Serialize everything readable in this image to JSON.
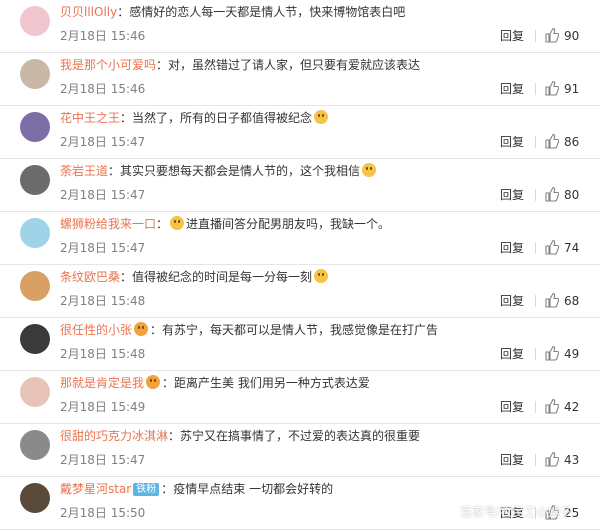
{
  "comments": [
    {
      "user": "贝贝lllOlly",
      "text": "：感情好的恋人每一天都是情人节，快来博物馆表白吧",
      "time": "2月18日 15:46",
      "reply": "回复",
      "likes": "90",
      "avatar_color": "#f2c6cf",
      "emoji": null,
      "badge": null,
      "prefix_emoji": false
    },
    {
      "user": "我是那个小可爱吗",
      "text": "：对，虽然错过了请人家，但只要有爱就应该表达",
      "time": "2月18日 15:46",
      "reply": "回复",
      "likes": "91",
      "avatar_color": "#c9b8a6",
      "emoji": null,
      "badge": null,
      "prefix_emoji": false
    },
    {
      "user": "花中王之王",
      "text": "：当然了，所有的日子都值得被纪念",
      "time": "2月18日 15:47",
      "reply": "回复",
      "likes": "86",
      "avatar_color": "#7d6ea8",
      "emoji": "smile",
      "badge": null,
      "prefix_emoji": false
    },
    {
      "user": "荼岩王道",
      "text": "：其实只要想每天都会是情人节的，这个我相信",
      "time": "2月18日 15:47",
      "reply": "回复",
      "likes": "80",
      "avatar_color": "#6b6b6b",
      "emoji": "grin",
      "badge": null,
      "prefix_emoji": false
    },
    {
      "user": "螺狮粉给我来一口",
      "text": "进直播间答分配男朋友吗，我缺一个。",
      "time": "2月18日 15:47",
      "reply": "回复",
      "likes": "74",
      "avatar_color": "#9fd3e8",
      "emoji": null,
      "badge": null,
      "prefix_emoji": true,
      "name_suffix": "："
    },
    {
      "user": "条纹欧巴桑",
      "text": "：值得被纪念的时间是每一分每一刻",
      "time": "2月18日 15:48",
      "reply": "回复",
      "likes": "68",
      "avatar_color": "#d9a066",
      "emoji": "wow",
      "badge": null,
      "prefix_emoji": false
    },
    {
      "user": "很任性的小张",
      "text": "：有苏宁，每天都可以是情人节，我感觉像是在打广告",
      "time": "2月18日 15:48",
      "reply": "回复",
      "likes": "49",
      "avatar_color": "#3a3a3a",
      "emoji": null,
      "badge": null,
      "prefix_emoji": false,
      "name_emoji": true
    },
    {
      "user": "那就是肯定是我",
      "text": "：距离产生美  我们用另一种方式表达爱",
      "time": "2月18日 15:49",
      "reply": "回复",
      "likes": "42",
      "avatar_color": "#e8c4b8",
      "emoji": null,
      "badge": null,
      "prefix_emoji": false,
      "name_emoji": true
    },
    {
      "user": "很甜的巧克力冰淇淋",
      "text": "：苏宁又在搞事情了，不过爱的表达真的很重要",
      "time": "2月18日 15:47",
      "reply": "回复",
      "likes": "43",
      "avatar_color": "#8a8a8a",
      "emoji": null,
      "badge": null,
      "prefix_emoji": false
    },
    {
      "user": "戴梦星河star",
      "text": "：疫情早点结束 一切都会好转的",
      "time": "2月18日 15:50",
      "reply": "回复",
      "likes": "25",
      "avatar_color": "#5a4a3a",
      "emoji": null,
      "badge": "铁粉",
      "prefix_emoji": false
    }
  ],
  "watermark": "百家号/农民工小嫂子"
}
